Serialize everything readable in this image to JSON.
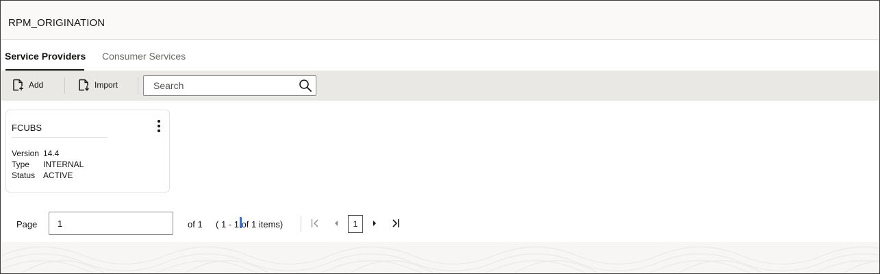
{
  "app": {
    "title": "RPM_ORIGINATION"
  },
  "tabs": [
    {
      "label": "Service Providers",
      "active": true
    },
    {
      "label": "Consumer Services",
      "active": false
    }
  ],
  "toolbar": {
    "add_label": "Add",
    "import_label": "Import",
    "search": {
      "placeholder": "Search",
      "value": ""
    }
  },
  "cards": [
    {
      "name": "FCUBS",
      "fields": [
        {
          "key": "Version",
          "value": "14.4"
        },
        {
          "key": "Type",
          "value": "INTERNAL"
        },
        {
          "key": "Status",
          "value": "ACTIVE"
        }
      ]
    }
  ],
  "pager": {
    "label": "Page",
    "current_page": "1",
    "of_text": "of 1",
    "range_text": "( 1 - 1 of 1 items)",
    "page_button": "1"
  },
  "colors": {
    "title_bg": "#fbf9f8",
    "toolbar_bg": "#eae8e5",
    "text": "#161513",
    "muted_text": "#6b6965",
    "caret": "#3b6fd6"
  },
  "icons": {
    "add": "add-document-icon",
    "import": "import-document-icon",
    "search": "search-icon",
    "card_menu": "vertical-ellipsis-icon",
    "first": "first-page-icon",
    "prev": "previous-page-icon",
    "next": "next-page-icon",
    "last": "last-page-icon"
  }
}
